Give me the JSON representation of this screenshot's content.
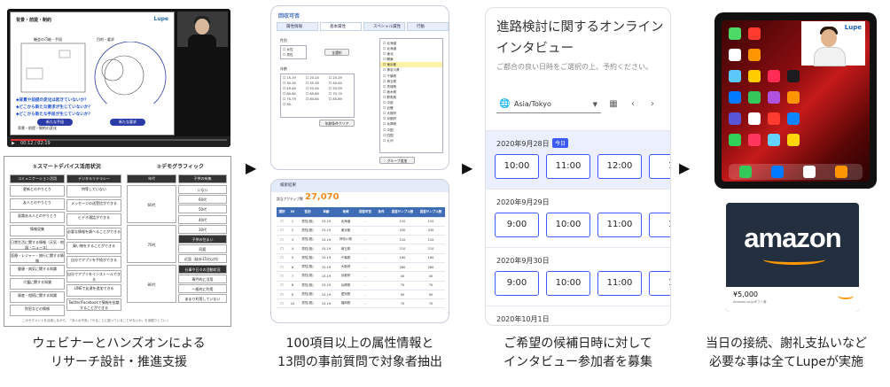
{
  "arrows": [
    "▶",
    "▶",
    "▶"
  ],
  "panel1": {
    "slide": {
      "title": "背景・前提・制約",
      "logo": "Lupe",
      "label_left": "機会の可能・手段",
      "label_right": "目的・要求",
      "questions": [
        "◆背景や前提の変化は起きていないか？",
        "◆どこから新たな要求が生じていないか？",
        "◆どこから新たな手段が生じていないか？"
      ],
      "bubble_left": "新たな手段",
      "bubble_right": "新たな要求",
      "bottom_text": "背景・前提・制約の変化"
    },
    "controls": {
      "play": "▶",
      "time": "00:12 / 02:19"
    },
    "table": {
      "heading_left": "①スマートデバイス活用状況",
      "heading_right": "②デモグラフィック",
      "col_a": "コミュニケーション活用",
      "col_b": "デジタルリテラシー",
      "col_c": "年代",
      "col_d": "子供の有無",
      "rows_a": [
        "更新とのやりとり",
        "友人とのやりとり",
        "面識ある人とのやりとり",
        "情報収集",
        "日常生活に関する情報（天気・地図・ニュース）",
        "医療・レジャー・旅行に関する情報",
        "健康・病気に関する知識",
        "介護に関する知識",
        "資産・相続に関する知識",
        "防犯などの情報"
      ],
      "rows_b": [
        "特等していない",
        "メッセージの送受信ができる",
        "ビデオ通話ができる",
        "必要な情報を調べることができる",
        "買い物をすることができる",
        "自分でアプリを手続ができる",
        "自分でアプリをインストールできる",
        "LINEで友達を追加できる",
        "Twitter/Facebookで情報を拡散することができる"
      ],
      "rows_c": [
        "60代",
        "70代",
        "80代"
      ],
      "rows_d": [
        "いない",
        "60代",
        "50代",
        "40代",
        "30代",
        "子供の住まい",
        "同居",
        "近居（徒歩15分以内）",
        "仕事や日々の活動状況",
        "専門的に活用",
        "一般的に利用",
        "あまり利用していない"
      ],
      "footnote": "このセグメントを活用しながら、「本人の不安」「やることに困っていることがないか」を深掘りしていく"
    }
  },
  "panel2": {
    "title": "回収可否",
    "tabs": [
      "属性情報",
      "基本属性",
      "スペシャル属性",
      "行動"
    ],
    "gender_label": "性別",
    "gender_options": [
      "女性",
      "男性"
    ],
    "age_label": "年齢",
    "age_options": [
      "15-19",
      "20-24",
      "25-29",
      "30-34",
      "35-39",
      "40-44",
      "45-49",
      "50-54",
      "55-59",
      "60-64",
      "65-69",
      "70-74",
      "75-79",
      "80-84",
      "85-89",
      "90-"
    ],
    "prefectures": [
      "北海道",
      "北海道",
      "東北",
      "関東",
      "東京都",
      "神奈川県",
      "千葉県",
      "埼玉県",
      "茨城県",
      "栃木県",
      "群馬県",
      "中部",
      "近畿",
      "大阪府",
      "京都府",
      "兵庫県",
      "中国",
      "四国",
      "九州"
    ],
    "buttons": {
      "all": "全選択",
      "clear": "年齢条件クリア",
      "group": "グループ追加"
    },
    "results_label": "検索結果",
    "count_label": "該当アクティブ数",
    "count": "27,070",
    "table_headers": [
      "選択",
      "ID",
      "性別",
      "年齢",
      "地域",
      "回答可否",
      "条件",
      "回答サンプル数",
      "回答サンプル数"
    ],
    "table_rows": [
      [
        "男性(既)",
        "15-19",
        "北海道",
        "-",
        "110",
        "110"
      ],
      [
        "男性(既)",
        "15-19",
        "東京都",
        "-",
        "430",
        "430"
      ],
      [
        "男性(既)",
        "15-19",
        "神奈川県",
        "-",
        "210",
        "210"
      ],
      [
        "男性(既)",
        "15-19",
        "埼玉県",
        "-",
        "210",
        "210"
      ],
      [
        "男性(既)",
        "15-19",
        "千葉県",
        "-",
        "180",
        "180"
      ],
      [
        "男性(既)",
        "15-19",
        "大阪府",
        "-",
        "280",
        "280"
      ],
      [
        "男性(既)",
        "15-19",
        "京都府",
        "-",
        "40",
        "40"
      ],
      [
        "男性(既)",
        "15-19",
        "兵庫県",
        "-",
        "70",
        "70"
      ],
      [
        "男性(既)",
        "15-19",
        "愛知県",
        "-",
        "90",
        "90"
      ],
      [
        "男性(既)",
        "15-19",
        "福岡県",
        "-",
        "70",
        "70"
      ]
    ]
  },
  "panel3": {
    "title": "進路検討に関するオンラインインタビュー",
    "subtitle": "ご都合の良い日時をご選択の上、予約ください。",
    "timezone": "Asia/Tokyo",
    "today_badge": "今日",
    "days": [
      {
        "date": "2020年9月28日",
        "today": true,
        "slots": [
          "10:00",
          "11:00",
          "12:00",
          "1"
        ]
      },
      {
        "date": "2020年9月29日",
        "today": false,
        "slots": [
          "9:00",
          "10:00",
          "11:00",
          "1"
        ]
      },
      {
        "date": "2020年9月30日",
        "today": false,
        "slots": [
          "9:00",
          "10:00",
          "11:00",
          "1"
        ]
      },
      {
        "date": "2020年10月1日",
        "today": false,
        "slots": [
          "",
          "",
          "",
          ""
        ]
      }
    ]
  },
  "panel4": {
    "cam_logo": "Lupe",
    "card_brand": "amazon",
    "card_amount": "¥5,000",
    "card_small": "Amazon.co.jpギフト券"
  },
  "captions": [
    [
      "ウェビナーとハンズオンによる",
      "リサーチ設計・推進支援"
    ],
    [
      "100項目以上の属性情報と",
      "13問の事前質問で対象者抽出"
    ],
    [
      "ご希望の候補日時に対して",
      "インタビュー参加者を募集"
    ],
    [
      "当日の接続、謝礼支払いなど",
      "必要な事は全てLupeが実施"
    ]
  ],
  "colors": {
    "accent": "#3d5afe",
    "count": "#f08a1c",
    "amazon_bg": "#232f3e",
    "amazon_orange": "#ff9900"
  }
}
